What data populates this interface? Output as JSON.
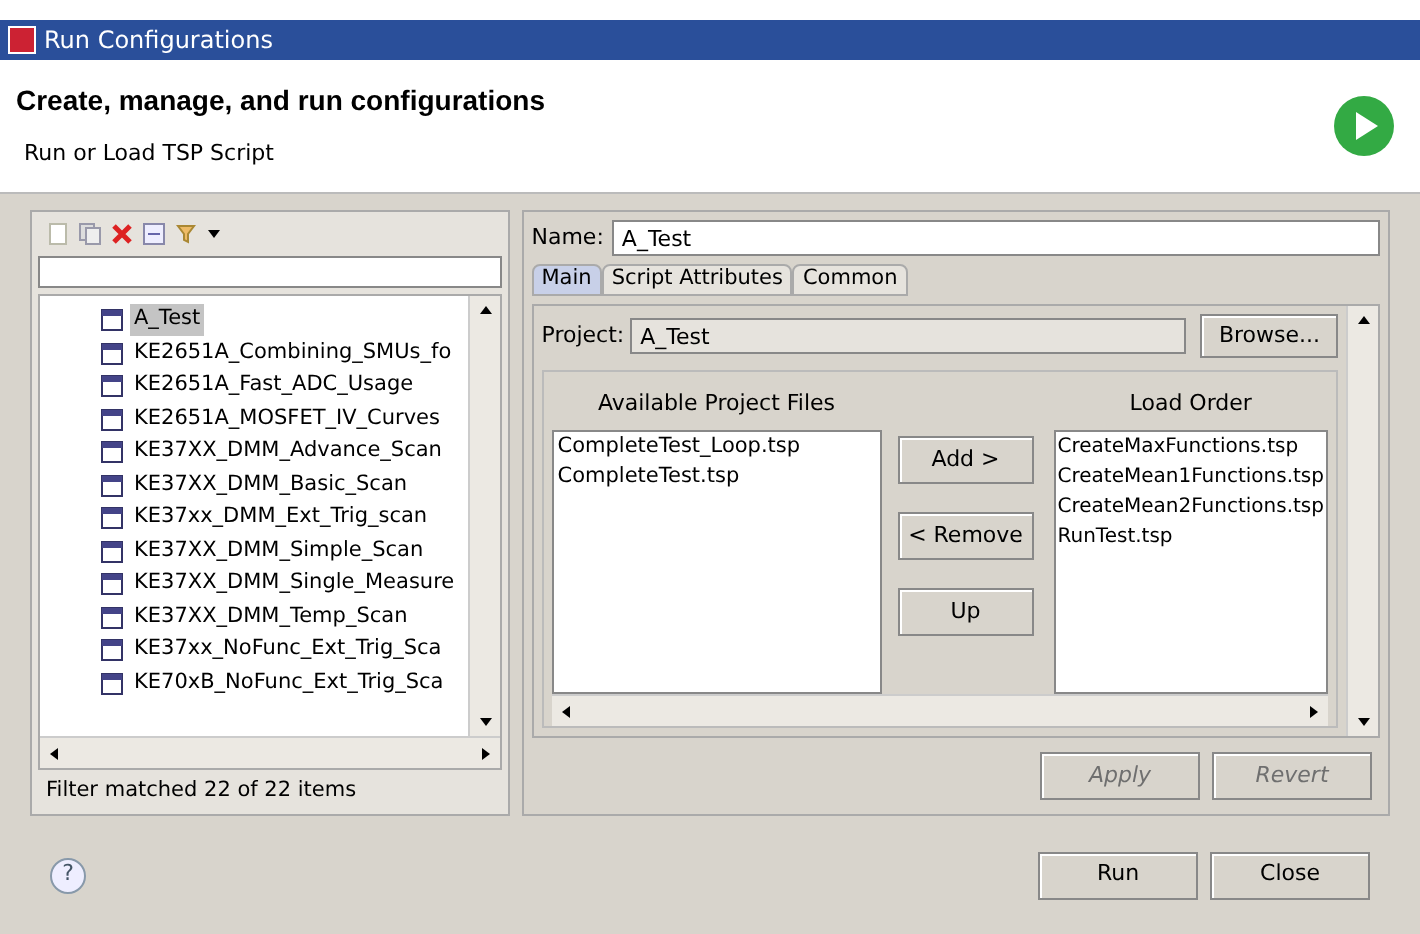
{
  "window": {
    "title": "Run Configurations"
  },
  "header": {
    "title": "Create, manage, and run configurations",
    "subtitle": "Run or Load TSP Script"
  },
  "help": "?",
  "tree": {
    "items": [
      {
        "label": "A_Test",
        "selected": true
      },
      {
        "label": "KE2651A_Combining_SMUs_fo",
        "selected": false
      },
      {
        "label": "KE2651A_Fast_ADC_Usage",
        "selected": false
      },
      {
        "label": "KE2651A_MOSFET_IV_Curves",
        "selected": false
      },
      {
        "label": "KE37XX_DMM_Advance_Scan",
        "selected": false
      },
      {
        "label": "KE37XX_DMM_Basic_Scan",
        "selected": false
      },
      {
        "label": "KE37xx_DMM_Ext_Trig_scan",
        "selected": false
      },
      {
        "label": "KE37XX_DMM_Simple_Scan",
        "selected": false
      },
      {
        "label": "KE37XX_DMM_Single_Measure",
        "selected": false
      },
      {
        "label": "KE37XX_DMM_Temp_Scan",
        "selected": false
      },
      {
        "label": "KE37xx_NoFunc_Ext_Trig_Sca",
        "selected": false
      },
      {
        "label": "KE70xB_NoFunc_Ext_Trig_Sca",
        "selected": false
      }
    ]
  },
  "status": "Filter matched 22 of 22 items",
  "name_field": {
    "label": "Name:",
    "value": "A_Test"
  },
  "tabs": [
    {
      "label": "Main",
      "selected": true
    },
    {
      "label": "Script Attributes",
      "selected": false
    },
    {
      "label": "Common",
      "selected": false
    }
  ],
  "project": {
    "label": "Project:",
    "value": "A_Test",
    "button": "Browse..."
  },
  "available": {
    "title": "Available Project Files",
    "items": [
      "CompleteTest_Loop.tsp",
      "CompleteTest.tsp"
    ]
  },
  "load_order": {
    "title": "Load Order",
    "items": [
      "CreateMaxFunctions.tsp",
      "CreateMean1Functions.tsp",
      "CreateMean2Functions.tsp",
      "RunTest.tsp"
    ]
  },
  "move_buttons": [
    "Add >",
    "< Remove",
    "Up"
  ],
  "apply_buttons": [
    {
      "label": "Apply",
      "disabled": true
    },
    {
      "label": "Revert",
      "disabled": true
    }
  ],
  "footer_buttons": [
    "Run",
    "Close"
  ]
}
